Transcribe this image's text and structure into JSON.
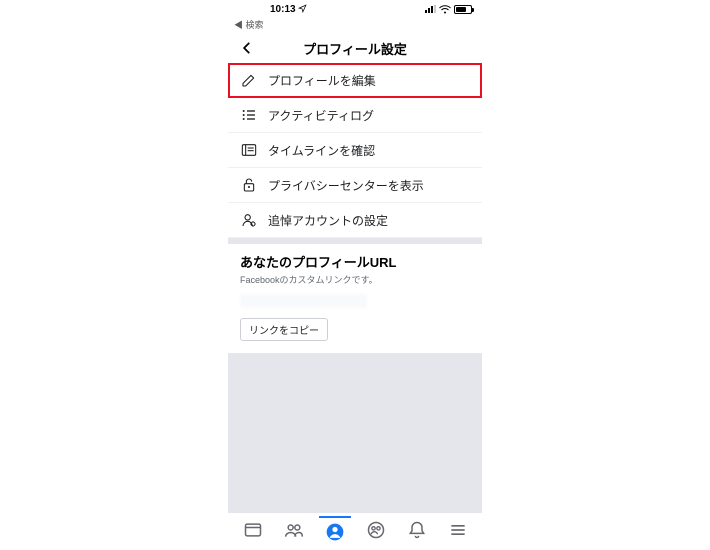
{
  "status": {
    "time": "10:13",
    "back_app": "◀ 検索"
  },
  "header": {
    "title": "プロフィール設定"
  },
  "menu": {
    "items": [
      {
        "label": "プロフィールを編集",
        "icon": "edit"
      },
      {
        "label": "アクティビティログ",
        "icon": "activity"
      },
      {
        "label": "タイムラインを確認",
        "icon": "timeline"
      },
      {
        "label": "プライバシーセンターを表示",
        "icon": "privacy"
      },
      {
        "label": "追悼アカウントの設定",
        "icon": "memorial"
      }
    ]
  },
  "url_section": {
    "title": "あなたのプロフィールURL",
    "subtitle": "Facebookのカスタムリンクです。",
    "copy_label": "リンクをコピー"
  },
  "colors": {
    "accent": "#1877f2",
    "highlight": "#e81123",
    "text": "#1c1e21",
    "muted": "#65676b"
  }
}
